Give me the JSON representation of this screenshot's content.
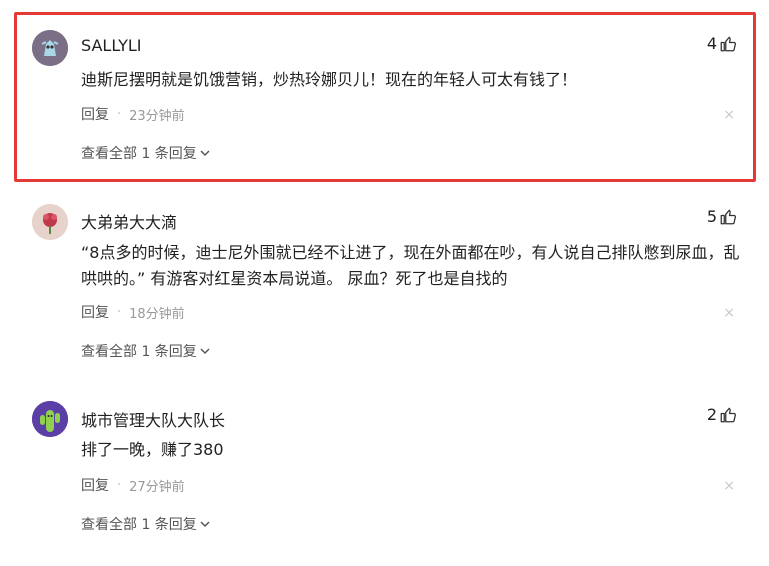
{
  "comments": [
    {
      "username": "SALLYLI",
      "likes": "4",
      "text": "迪斯尼摆明就是饥饿营销，炒热玲娜贝儿！现在的年轻人可太有钱了！",
      "reply_label": "回复",
      "time": "23分钟前",
      "view_all": "查看全部 1 条回复",
      "avatar_color": "#7a6f86",
      "highlighted": true
    },
    {
      "username": "大弟弟大大滴",
      "likes": "5",
      "text": "“8点多的时候，迪士尼外围就已经不让进了，现在外面都在吵，有人说自己排队憋到尿血，乱哄哄的。” 有游客对红星资本局说道。 尿血？死了也是自找的",
      "reply_label": "回复",
      "time": "18分钟前",
      "view_all": "查看全部 1 条回复",
      "avatar_color": "#b98b7a",
      "highlighted": false
    },
    {
      "username": "城市管理大队大队长",
      "likes": "2",
      "text": "排了一晚，赚了380",
      "reply_label": "回复",
      "time": "27分钟前",
      "view_all": "查看全部 1 条回复",
      "avatar_color": "#5b3fa6",
      "highlighted": false
    }
  ],
  "close_glyph": "×",
  "colors": {
    "highlight_border": "#e53935",
    "meta_text": "#999999"
  },
  "icons": {
    "like": "thumbs-up-icon",
    "close": "close-icon",
    "expand": "chevron-down-icon"
  }
}
